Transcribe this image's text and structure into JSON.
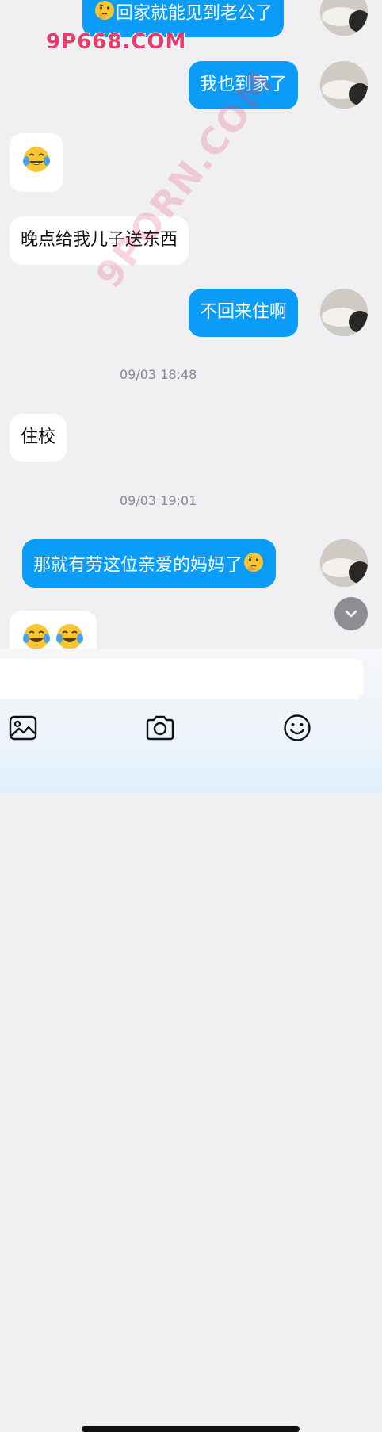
{
  "watermark": {
    "site": "9P668.COM",
    "diagonal": "9PORN.COM"
  },
  "messages": [
    {
      "side": "out",
      "text": "回家就能见到老公了",
      "emoji_before": "thinking-face"
    },
    {
      "side": "out",
      "text": "我也到家了"
    },
    {
      "side": "in",
      "emoji": "tears-of-joy"
    },
    {
      "side": "in",
      "text": "晚点给我儿子送东西"
    },
    {
      "side": "out",
      "text": "不回来住啊"
    },
    {
      "side": "time",
      "text": "09/03 18:48"
    },
    {
      "side": "in",
      "text": "住校"
    },
    {
      "side": "time",
      "text": "09/03 19:01"
    },
    {
      "side": "out",
      "text": "那就有劳这位亲爱的妈妈了",
      "emoji_after": "thinking-face"
    },
    {
      "side": "in",
      "emoji": "tears-of-joy x2"
    }
  ],
  "toolbar": {
    "icons": [
      "image-icon",
      "camera-icon",
      "emoji-icon"
    ]
  },
  "colors": {
    "outgoing": "#0a9cf6",
    "incoming": "#ffffff",
    "background": "#f0f0f2"
  }
}
